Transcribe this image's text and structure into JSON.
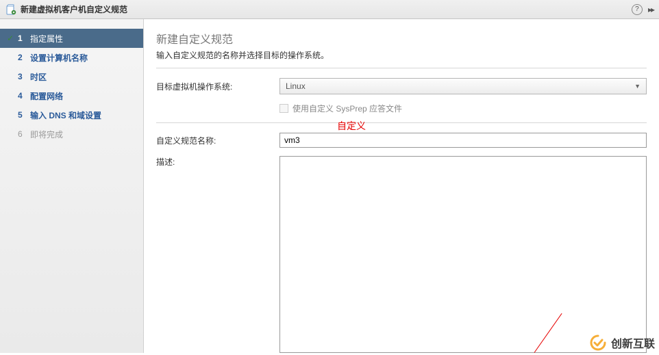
{
  "titlebar": {
    "title": "新建虚拟机客户机自定义规范",
    "help": "?",
    "expand": "▸▸"
  },
  "sidebar": {
    "steps": [
      {
        "num": "1",
        "label": "指定属性",
        "active": true,
        "completed": true
      },
      {
        "num": "2",
        "label": "设置计算机名称",
        "active": false,
        "completed": false
      },
      {
        "num": "3",
        "label": "时区",
        "active": false,
        "completed": false
      },
      {
        "num": "4",
        "label": "配置网络",
        "active": false,
        "completed": false
      },
      {
        "num": "5",
        "label": "输入 DNS 和域设置",
        "active": false,
        "completed": false
      },
      {
        "num": "6",
        "label": "即将完成",
        "active": false,
        "completed": false,
        "disabled": true
      }
    ]
  },
  "main": {
    "title": "新建自定义规范",
    "subtitle": "输入自定义规范的名称并选择目标的操作系统。",
    "os_label": "目标虚拟机操作系统:",
    "os_value": "Linux",
    "sysprep_label": "使用自定义 SysPrep 应答文件",
    "name_label": "自定义规范名称:",
    "name_value": "vm3",
    "desc_label": "描述:",
    "desc_value": ""
  },
  "annotation": {
    "text": "自定义"
  },
  "watermark": {
    "text": "创新互联"
  }
}
